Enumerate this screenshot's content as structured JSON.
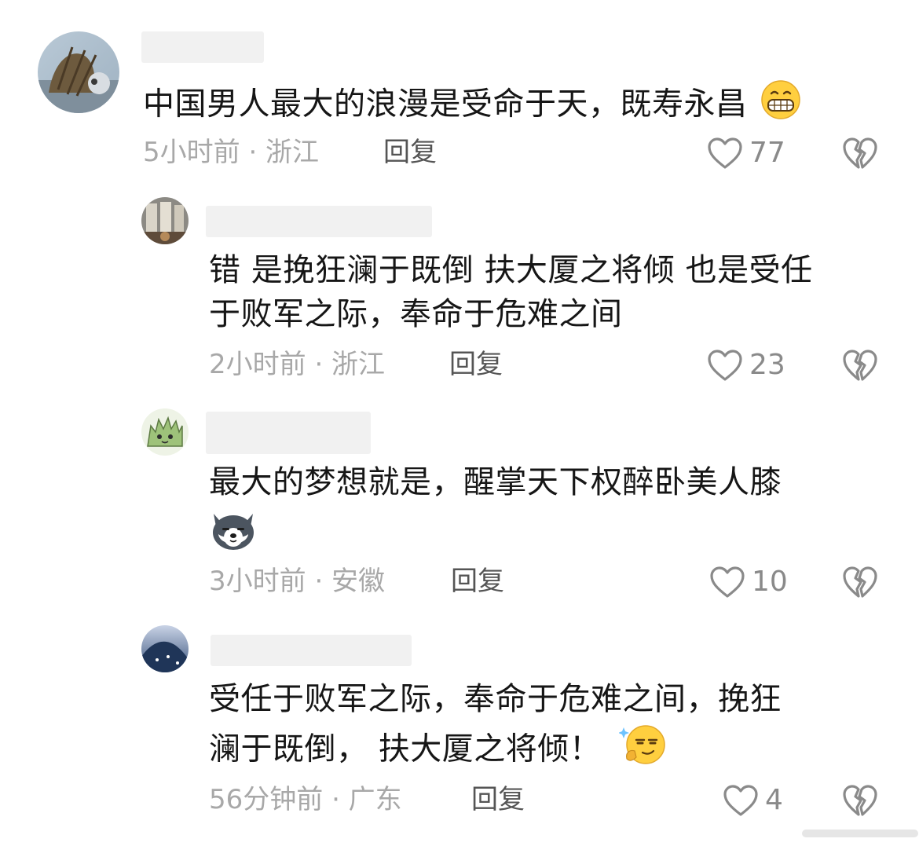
{
  "colors": {
    "text": "#161616",
    "meta": "#a8a8a8",
    "reply": "#555555",
    "icon": "#8a8a8a",
    "username_placeholder": "#f1f1f1"
  },
  "comments": [
    {
      "text_lines": [
        "中国男人最大的浪漫是受命于天，既寿永昌"
      ],
      "emoji": "grinning-face-emoji",
      "time_location": "5小时前 · 浙江",
      "reply_label": "回复",
      "likes": "77"
    },
    {
      "text_lines": [
        "错 是挽狂澜于既倒 扶大厦之将倾 也是受任",
        "于败军之际，奉命于危难之间"
      ],
      "time_location": "2小时前 · 浙江",
      "reply_label": "回复",
      "likes": "23"
    },
    {
      "text_lines": [
        "最大的梦想就是，醒掌天下权醉卧美人膝"
      ],
      "emoji": "husky-dog-emoji",
      "time_location": "3小时前 · 安徽",
      "reply_label": "回复",
      "likes": "10"
    },
    {
      "text_lines": [
        "受任于败军之际，奉命于危难之间，挽狂",
        "澜于既倒， 扶大厦之将倾！"
      ],
      "emoji": "thinking-smug-emoji",
      "time_location": "56分钟前 · 广东",
      "reply_label": "回复",
      "likes": "4"
    }
  ]
}
